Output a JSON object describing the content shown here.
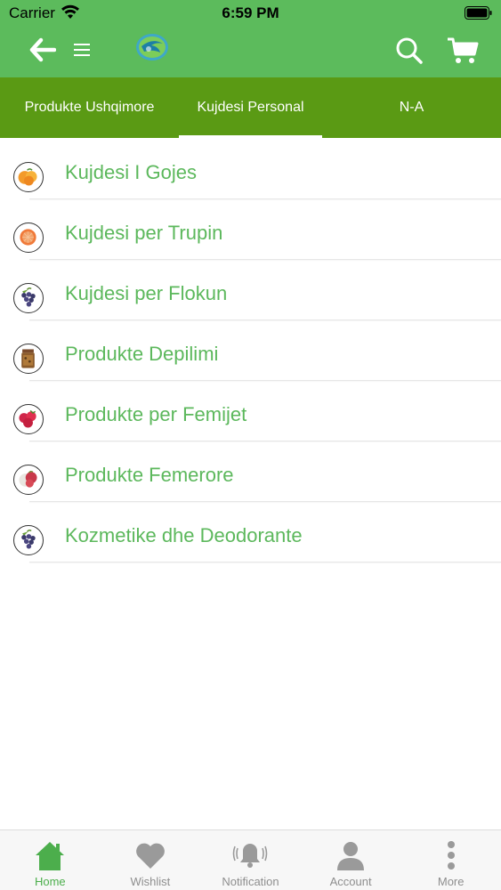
{
  "status_bar": {
    "carrier": "Carrier",
    "time": "6:59 PM"
  },
  "header": {
    "back_icon": "arrow-left-icon",
    "menu_icon": "hamburger-icon",
    "logo": "brand-logo",
    "search_icon": "search-icon",
    "cart_icon": "cart-icon"
  },
  "tabs": [
    {
      "label": "Produkte Ushqimore",
      "active": false
    },
    {
      "label": "Kujdesi Personal",
      "active": true
    },
    {
      "label": "N-A",
      "active": false
    }
  ],
  "categories": [
    {
      "label": "Kujdesi I Gojes",
      "icon": "orange-fruit-icon"
    },
    {
      "label": "Kujdesi per Trupin",
      "icon": "grapefruit-icon"
    },
    {
      "label": "Kujdesi per Flokun",
      "icon": "grapes-icon"
    },
    {
      "label": "Produkte Depilimi",
      "icon": "jar-icon"
    },
    {
      "label": "Produkte per Femijet",
      "icon": "raspberries-icon"
    },
    {
      "label": "Produkte Femerore",
      "icon": "lychee-icon"
    },
    {
      "label": "Kozmetike dhe Deodorante",
      "icon": "grapes-icon"
    }
  ],
  "tabbar": [
    {
      "label": "Home",
      "icon": "home-icon",
      "active": true
    },
    {
      "label": "Wishlist",
      "icon": "heart-icon",
      "active": false
    },
    {
      "label": "Notification",
      "icon": "bell-icon",
      "active": false
    },
    {
      "label": "Account",
      "icon": "user-icon",
      "active": false
    },
    {
      "label": "More",
      "icon": "more-vertical-icon",
      "active": false
    }
  ],
  "colors": {
    "header_green": "#5cbb5c",
    "tab_green": "#5a9a14",
    "label_green": "#5cb85c",
    "active_tab_green": "#4cae4c"
  }
}
